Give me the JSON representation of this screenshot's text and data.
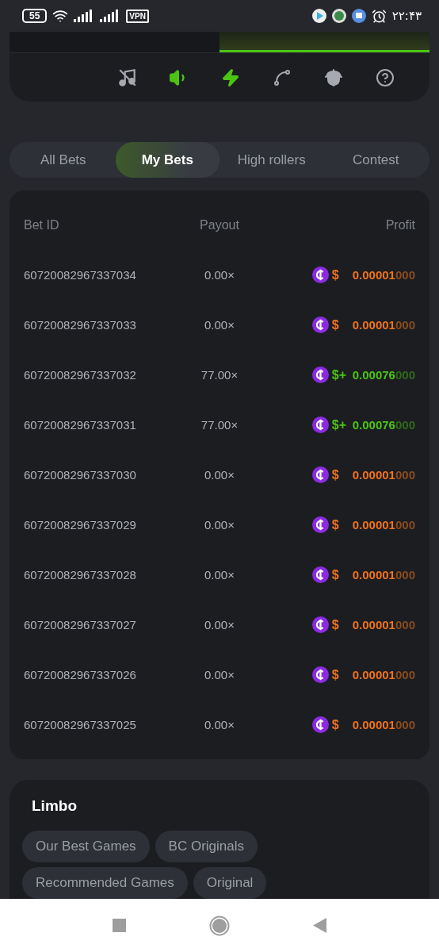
{
  "status_bar": {
    "battery": "55",
    "vpn": "VPN",
    "time": "۲۲:۴۳"
  },
  "top_panel": {
    "segments": [
      {
        "selected": false
      },
      {
        "selected": true
      }
    ],
    "controls": [
      {
        "kind": "music",
        "on": false
      },
      {
        "kind": "sound",
        "on": true
      },
      {
        "kind": "turbo",
        "on": true
      },
      {
        "kind": "curve",
        "on": false
      },
      {
        "kind": "acorn",
        "on": false
      },
      {
        "kind": "help",
        "on": false
      }
    ]
  },
  "tabs": [
    {
      "label": "All Bets",
      "selected": false
    },
    {
      "label": "My Bets",
      "selected": true
    },
    {
      "label": "High rollers",
      "selected": false
    },
    {
      "label": "Contest",
      "selected": false
    }
  ],
  "table": {
    "columns": [
      "Bet ID",
      "Payout",
      "Profit"
    ],
    "rows": [
      {
        "bet_id": "60720082967337034",
        "payout": "0.00×",
        "kind": "loss",
        "currency": "$",
        "sign": "",
        "amount": "0.00001",
        "trail": "000"
      },
      {
        "bet_id": "60720082967337033",
        "payout": "0.00×",
        "kind": "loss",
        "currency": "$",
        "sign": "",
        "amount": "0.00001",
        "trail": "000"
      },
      {
        "bet_id": "60720082967337032",
        "payout": "77.00×",
        "kind": "win",
        "currency": "$",
        "sign": "+",
        "amount": "0.00076",
        "trail": "000"
      },
      {
        "bet_id": "60720082967337031",
        "payout": "77.00×",
        "kind": "win",
        "currency": "$",
        "sign": "+",
        "amount": "0.00076",
        "trail": "000"
      },
      {
        "bet_id": "60720082967337030",
        "payout": "0.00×",
        "kind": "loss",
        "currency": "$",
        "sign": "",
        "amount": "0.00001",
        "trail": "000"
      },
      {
        "bet_id": "60720082967337029",
        "payout": "0.00×",
        "kind": "loss",
        "currency": "$",
        "sign": "",
        "amount": "0.00001",
        "trail": "000"
      },
      {
        "bet_id": "60720082967337028",
        "payout": "0.00×",
        "kind": "loss",
        "currency": "$",
        "sign": "",
        "amount": "0.00001",
        "trail": "000"
      },
      {
        "bet_id": "60720082967337027",
        "payout": "0.00×",
        "kind": "loss",
        "currency": "$",
        "sign": "",
        "amount": "0.00001",
        "trail": "000"
      },
      {
        "bet_id": "60720082967337026",
        "payout": "0.00×",
        "kind": "loss",
        "currency": "$",
        "sign": "",
        "amount": "0.00001",
        "trail": "000"
      },
      {
        "bet_id": "60720082967337025",
        "payout": "0.00×",
        "kind": "loss",
        "currency": "$",
        "sign": "",
        "amount": "0.00001",
        "trail": "000"
      }
    ]
  },
  "game_card": {
    "title": "Limbo",
    "tags": [
      "Our Best Games",
      "BC Originals",
      "Recommended Games",
      "Original"
    ]
  }
}
